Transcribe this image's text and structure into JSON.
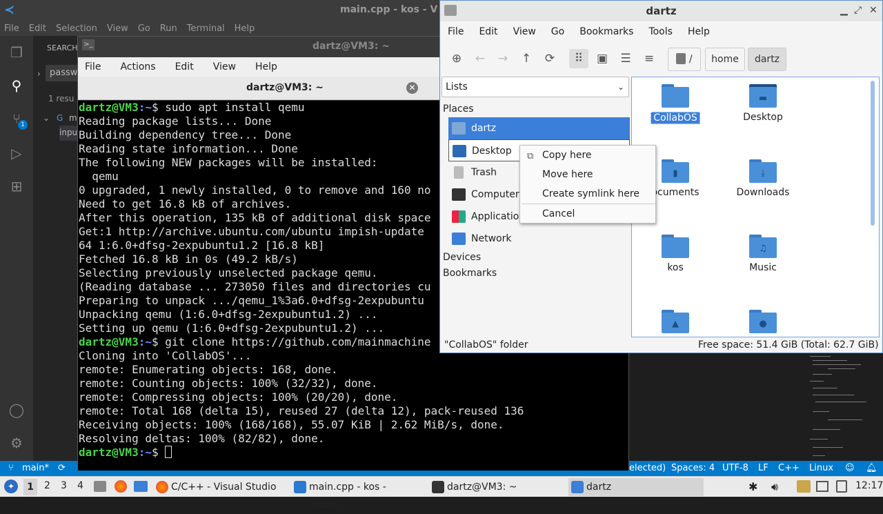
{
  "vscode": {
    "title": "main.cpp - kos - V",
    "menu": [
      "File",
      "Edit",
      "Selection",
      "View",
      "Go",
      "Run",
      "Terminal",
      "Help"
    ],
    "sidebar": {
      "header": "SEARCH",
      "search_value": "passw",
      "result_text": "1 resu",
      "file_letter": "m",
      "match_text": "inpu"
    },
    "badge_count": "1",
    "status": {
      "branch": "main*",
      "selected": "elected)",
      "spaces": "Spaces: 4",
      "encoding": "UTF-8",
      "eol": "LF",
      "language": "C++",
      "os": "Linux"
    }
  },
  "terminal": {
    "window_title": "dartz@VM3: ~",
    "menu": [
      "File",
      "Actions",
      "Edit",
      "View",
      "Help"
    ],
    "tab_title": "dartz@VM3: ~",
    "prompt_user": "dartz@VM3",
    "prompt_path": ":~",
    "prompt_sign": "$",
    "cmd1": " sudo apt install qemu",
    "out1": [
      "Reading package lists... Done",
      "Building dependency tree... Done",
      "Reading state information... Done",
      "The following NEW packages will be installed:",
      "  qemu",
      "0 upgraded, 1 newly installed, 0 to remove and 160 no",
      "Need to get 16.8 kB of archives.",
      "After this operation, 135 kB of additional disk space",
      "Get:1 http://archive.ubuntu.com/ubuntu impish-update",
      "64 1:6.0+dfsg-2expubuntu1.2 [16.8 kB]",
      "Fetched 16.8 kB in 0s (49.2 kB/s)",
      "Selecting previously unselected package qemu.",
      "(Reading database ... 273050 files and directories cu",
      "Preparing to unpack .../qemu_1%3a6.0+dfsg-2expubuntu",
      "Unpacking qemu (1:6.0+dfsg-2expubuntu1.2) ...",
      "Setting up qemu (1:6.0+dfsg-2expubuntu1.2) ..."
    ],
    "cmd2": " git clone https://github.com/mainmachine",
    "out2": [
      "Cloning into 'CollabOS'...",
      "remote: Enumerating objects: 168, done.",
      "remote: Counting objects: 100% (32/32), done.",
      "remote: Compressing objects: 100% (20/20), done.",
      "remote: Total 168 (delta 15), reused 27 (delta 12), pack-reused 136",
      "Receiving objects: 100% (168/168), 55.07 KiB | 2.62 MiB/s, done.",
      "Resolving deltas: 100% (82/82), done."
    ]
  },
  "filemanager": {
    "title": "dartz",
    "menu": [
      "File",
      "Edit",
      "View",
      "Go",
      "Bookmarks",
      "Tools",
      "Help"
    ],
    "path": {
      "root": "/",
      "home": "home",
      "current": "dartz"
    },
    "side_select": "Lists",
    "places_header": "Places",
    "places": [
      "dartz",
      "Desktop",
      "Trash",
      "Computer",
      "Applicatio",
      "Network"
    ],
    "devices_header": "Devices",
    "bookmarks_header": "Bookmarks",
    "files": [
      "CollabOS",
      "Desktop",
      "ocuments",
      "Downloads",
      "kos",
      "Music"
    ],
    "status_left": "\"CollabOS\" folder",
    "status_right": "Free space: 51.4 GiB (Total: 62.7 GiB)"
  },
  "context_menu": {
    "copy": "Copy here",
    "move": "Move here",
    "symlink": "Create symlink here",
    "cancel": "Cancel"
  },
  "taskbar": {
    "workspaces": [
      "1",
      "2",
      "3",
      "4"
    ],
    "tasks": [
      "C/C++ - Visual Studio ...",
      "main.cpp - kos - Visual...",
      "dartz@VM3: ~",
      "dartz"
    ],
    "clock": "12:17"
  }
}
